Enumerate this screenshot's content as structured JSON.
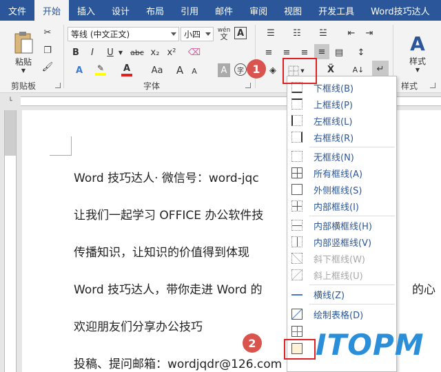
{
  "tabs": [
    "文件",
    "开始",
    "插入",
    "设计",
    "布局",
    "引用",
    "邮件",
    "审阅",
    "视图",
    "开发工具",
    "Word技巧达人"
  ],
  "active_tab": "开始",
  "ribbon": {
    "paste_label": "粘贴",
    "clipboard_label": "剪贴板",
    "font_name": "等线 (中文正文)",
    "font_size": "小四",
    "wen_glyph": "wén",
    "font_group_label": "字体",
    "styles_label": "样式",
    "styles_group_label": "样式",
    "bold": "B",
    "italic": "I",
    "underline": "U",
    "strike": "abc",
    "subscript": "x₂",
    "superscript": "x²",
    "font_color": "A",
    "change_case": "Aa",
    "grow": "A",
    "shrink": "A",
    "char_border": "A",
    "sort": "A↓"
  },
  "document_lines": [
    "Word 技巧达人· 微信号：word-jqc",
    "让我们一起学习 OFFICE 办公软件技",
    "传播知识，让知识的价值得到体现",
    "Word 技巧达人，带你走进 Word 的",
    "欢迎朋友们分享办公技巧",
    "投稿、提问邮箱：wordjqdr@126.com"
  ],
  "doc_line4_tail": "的心",
  "menu_items": [
    {
      "label": "下框线(B)",
      "disabled": false
    },
    {
      "label": "上框线(P)",
      "disabled": false
    },
    {
      "label": "左框线(L)",
      "disabled": false
    },
    {
      "label": "右框线(R)",
      "disabled": false
    },
    {
      "label": "无框线(N)",
      "disabled": false
    },
    {
      "label": "所有框线(A)",
      "disabled": false
    },
    {
      "label": "外侧框线(S)",
      "disabled": false
    },
    {
      "label": "内部框线(I)",
      "disabled": false
    },
    {
      "label": "内部横框线(H)",
      "disabled": false
    },
    {
      "label": "内部竖框线(V)",
      "disabled": false
    },
    {
      "label": "斜下框线(W)",
      "disabled": true
    },
    {
      "label": "斜上框线(U)",
      "disabled": true
    },
    {
      "label": "横线(Z)",
      "disabled": false
    },
    {
      "label": "绘制表格(D)",
      "disabled": false
    }
  ],
  "callouts": [
    "1",
    "2"
  ],
  "watermark": "ITOPM",
  "colors": {
    "tab_blue": "#2b579a",
    "callout_red": "#e02020",
    "highlight_yellow": "#ffff00",
    "font_red": "#e02020",
    "watermark_blue": "#2a8fd8"
  }
}
